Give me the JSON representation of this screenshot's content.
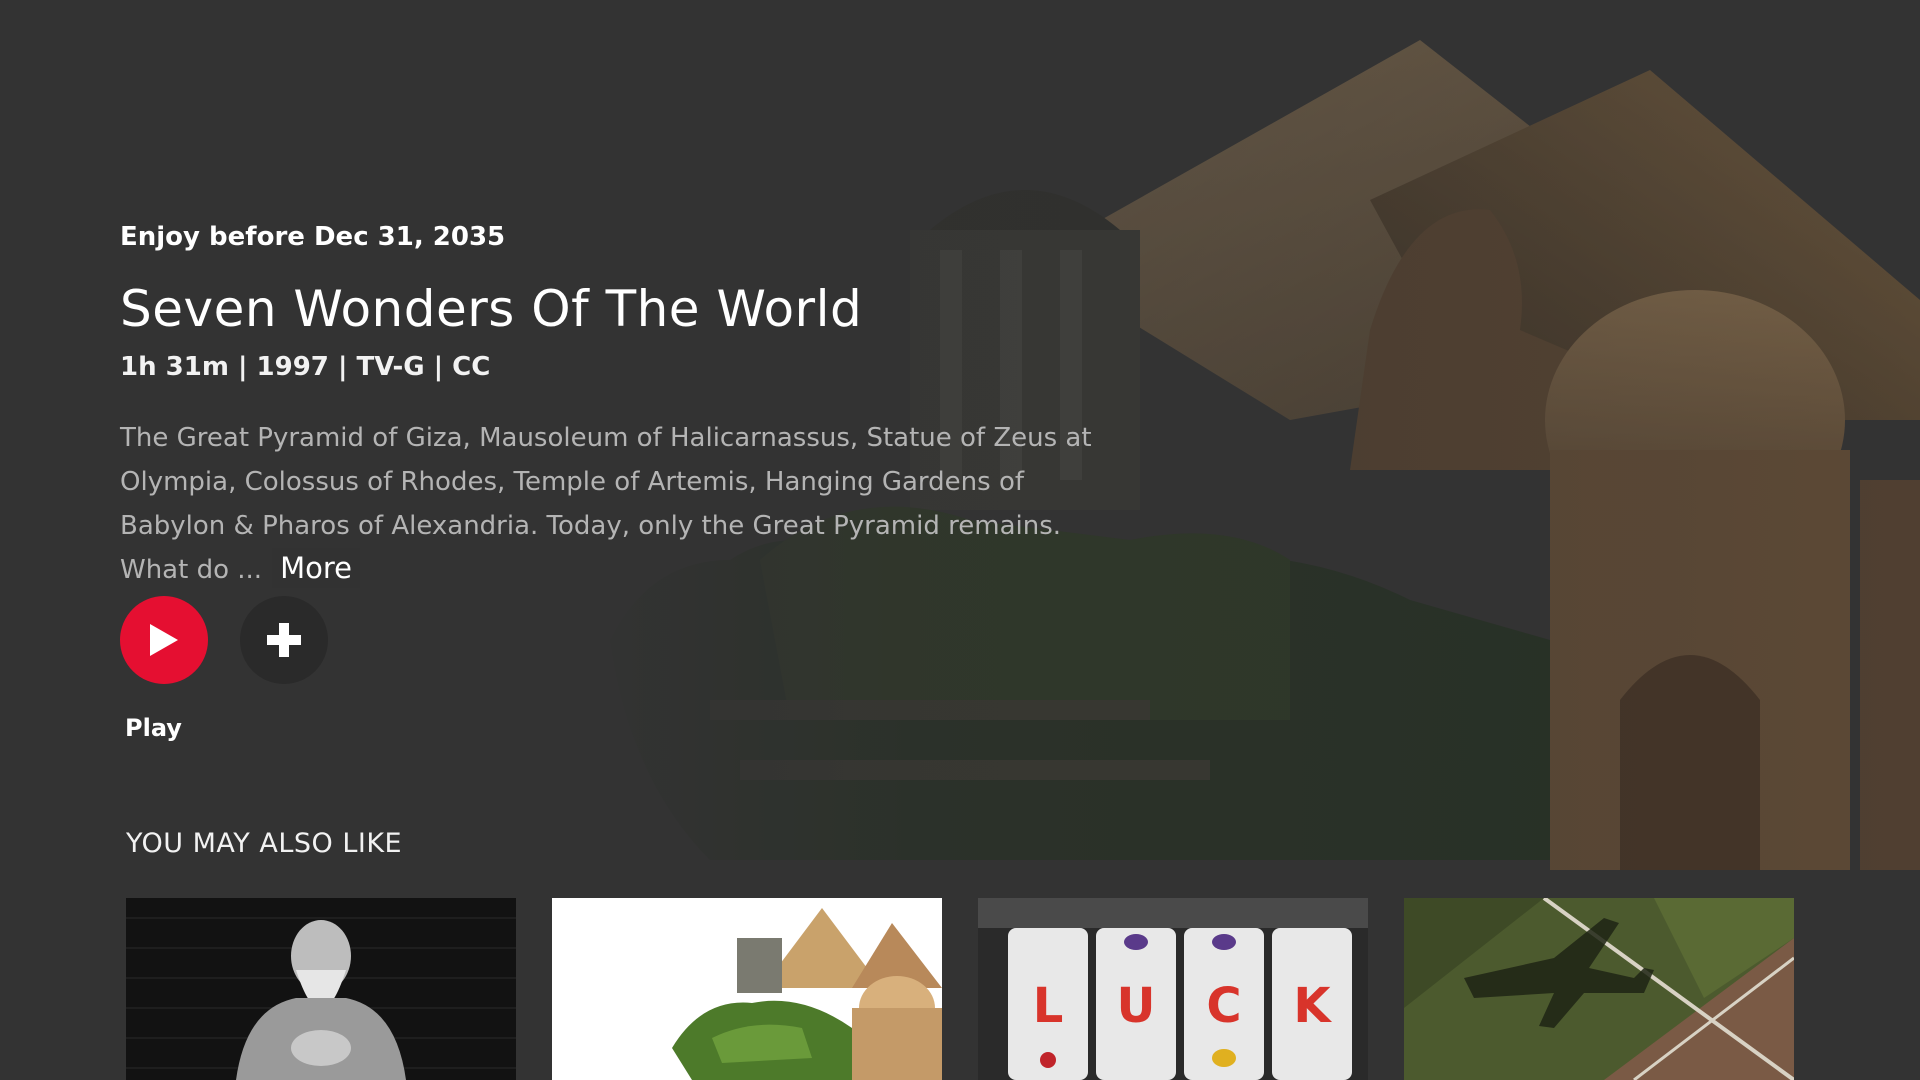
{
  "hero": {
    "availability": "Enjoy before Dec 31, 2035",
    "title": "Seven Wonders Of The World",
    "meta": "1h 31m | 1997 | TV-G | CC",
    "description": "The Great Pyramid of Giza, Mausoleum of Halicarnassus, Statue of Zeus at Olympia, Colossus of Rhodes, Temple of Artemis, Hanging Gardens of Babylon & Pharos of Alexandria. Today, only the Great Pyramid remains. What do ...",
    "more_label": "More",
    "play_label": "Play"
  },
  "section": {
    "title": "YOU MAY ALSO LIKE"
  },
  "recommendations": [
    {
      "thumb": "confucius-statue"
    },
    {
      "thumb": "seven-wonders-collage"
    },
    {
      "thumb": "luck-slot-machine",
      "reel_letters": [
        "L",
        "U",
        "C",
        "K"
      ]
    },
    {
      "thumb": "airplane-shadow-fields"
    }
  ],
  "colors": {
    "background": "#333333",
    "accent": "#e50f31"
  }
}
